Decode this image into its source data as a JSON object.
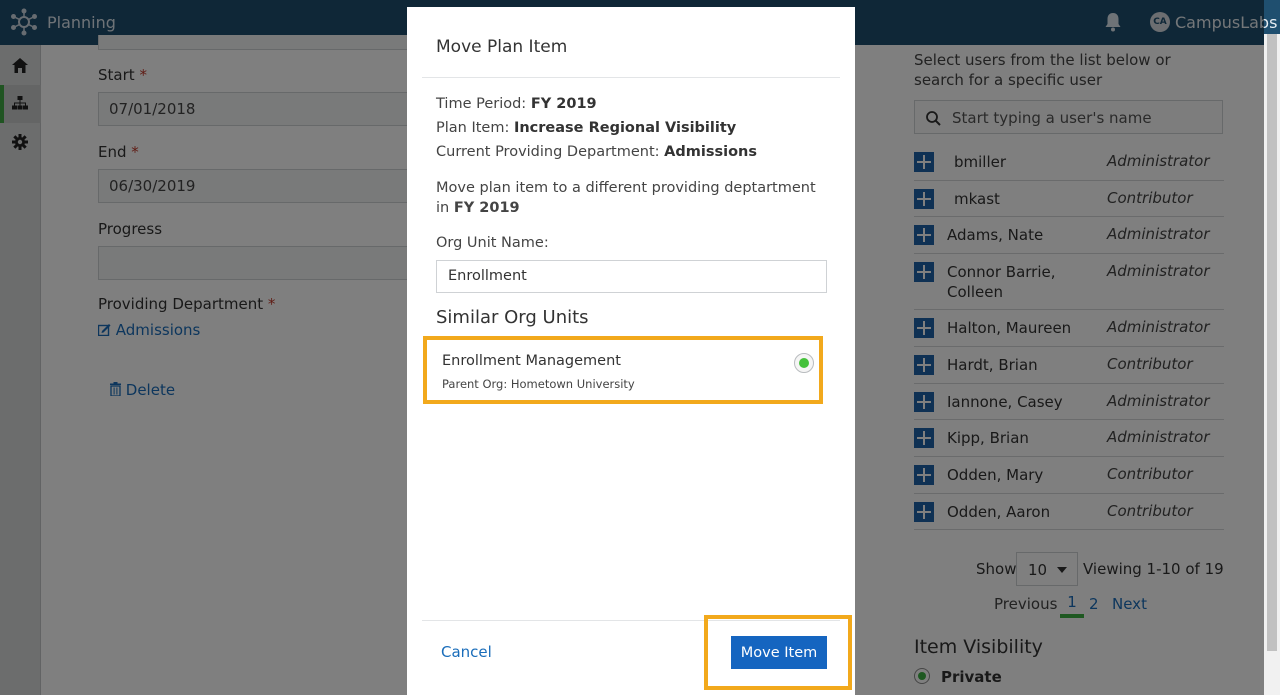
{
  "topbar": {
    "app_title": "Planning",
    "logo_icon": "hub-logo-icon",
    "bell_icon": "bell-icon",
    "avatar_initials": "CA",
    "org_name": "CampusLabs"
  },
  "rail": {
    "items": [
      {
        "icon": "home-icon"
      },
      {
        "icon": "org-chart-icon",
        "active": true
      },
      {
        "icon": "gear-icon"
      }
    ]
  },
  "form": {
    "start_label": "Start",
    "start_value": "07/01/2018",
    "end_label": "End",
    "end_value": "06/30/2019",
    "progress_label": "Progress",
    "providing_label": "Providing Department",
    "required_mark": "*",
    "providing_link": "Admissions",
    "delete_label": "Delete"
  },
  "right_panel": {
    "hint": "Select users from the list below or search for a specific user",
    "search_placeholder": "Start typing a user's name",
    "users": [
      {
        "name": "bmiller",
        "role": "Administrator"
      },
      {
        "name": "mkast",
        "role": "Contributor"
      },
      {
        "name": "Adams,  Nate",
        "role": "Administrator"
      },
      {
        "name": "Connor Barrie, Colleen",
        "role": "Administrator"
      },
      {
        "name": "Halton,  Maureen",
        "role": "Administrator"
      },
      {
        "name": "Hardt,  Brian",
        "role": "Contributor"
      },
      {
        "name": "Iannone,  Casey",
        "role": "Administrator"
      },
      {
        "name": "Kipp,  Brian",
        "role": "Administrator"
      },
      {
        "name": "Odden,  Mary",
        "role": "Contributor"
      },
      {
        "name": "Odden,  Aaron",
        "role": "Contributor"
      }
    ],
    "show_label": "Show",
    "show_value": "10",
    "viewing": "Viewing 1-10 of 19",
    "previous": "Previous",
    "page1": "1",
    "page2": "2",
    "next": "Next",
    "visibility_title": "Item Visibility",
    "visibility_option": "Private"
  },
  "modal": {
    "title": "Move Plan Item",
    "time_period_label": "Time Period:",
    "time_period_value": "FY 2019",
    "plan_item_label": "Plan Item:",
    "plan_item_value": "Increase Regional Visibility",
    "current_dept_label": "Current Providing Department:",
    "current_dept_value": "Admissions",
    "desc_text": "Move plan item to a different providing deptartment in",
    "desc_bold": "FY 2019",
    "org_unit_label": "Org Unit Name:",
    "org_unit_value": "Enrollment",
    "similar_title": "Similar Org Units",
    "unit_name": "Enrollment Management",
    "unit_parent": "Parent Org: Hometown University",
    "cancel_label": "Cancel",
    "move_label": "Move Item"
  },
  "colors": {
    "topbar": "#1f4f6f",
    "highlight": "#f2a91c",
    "primary_button": "#1565c0",
    "link": "#1a6dba",
    "radio_selected": "#44c13a"
  }
}
